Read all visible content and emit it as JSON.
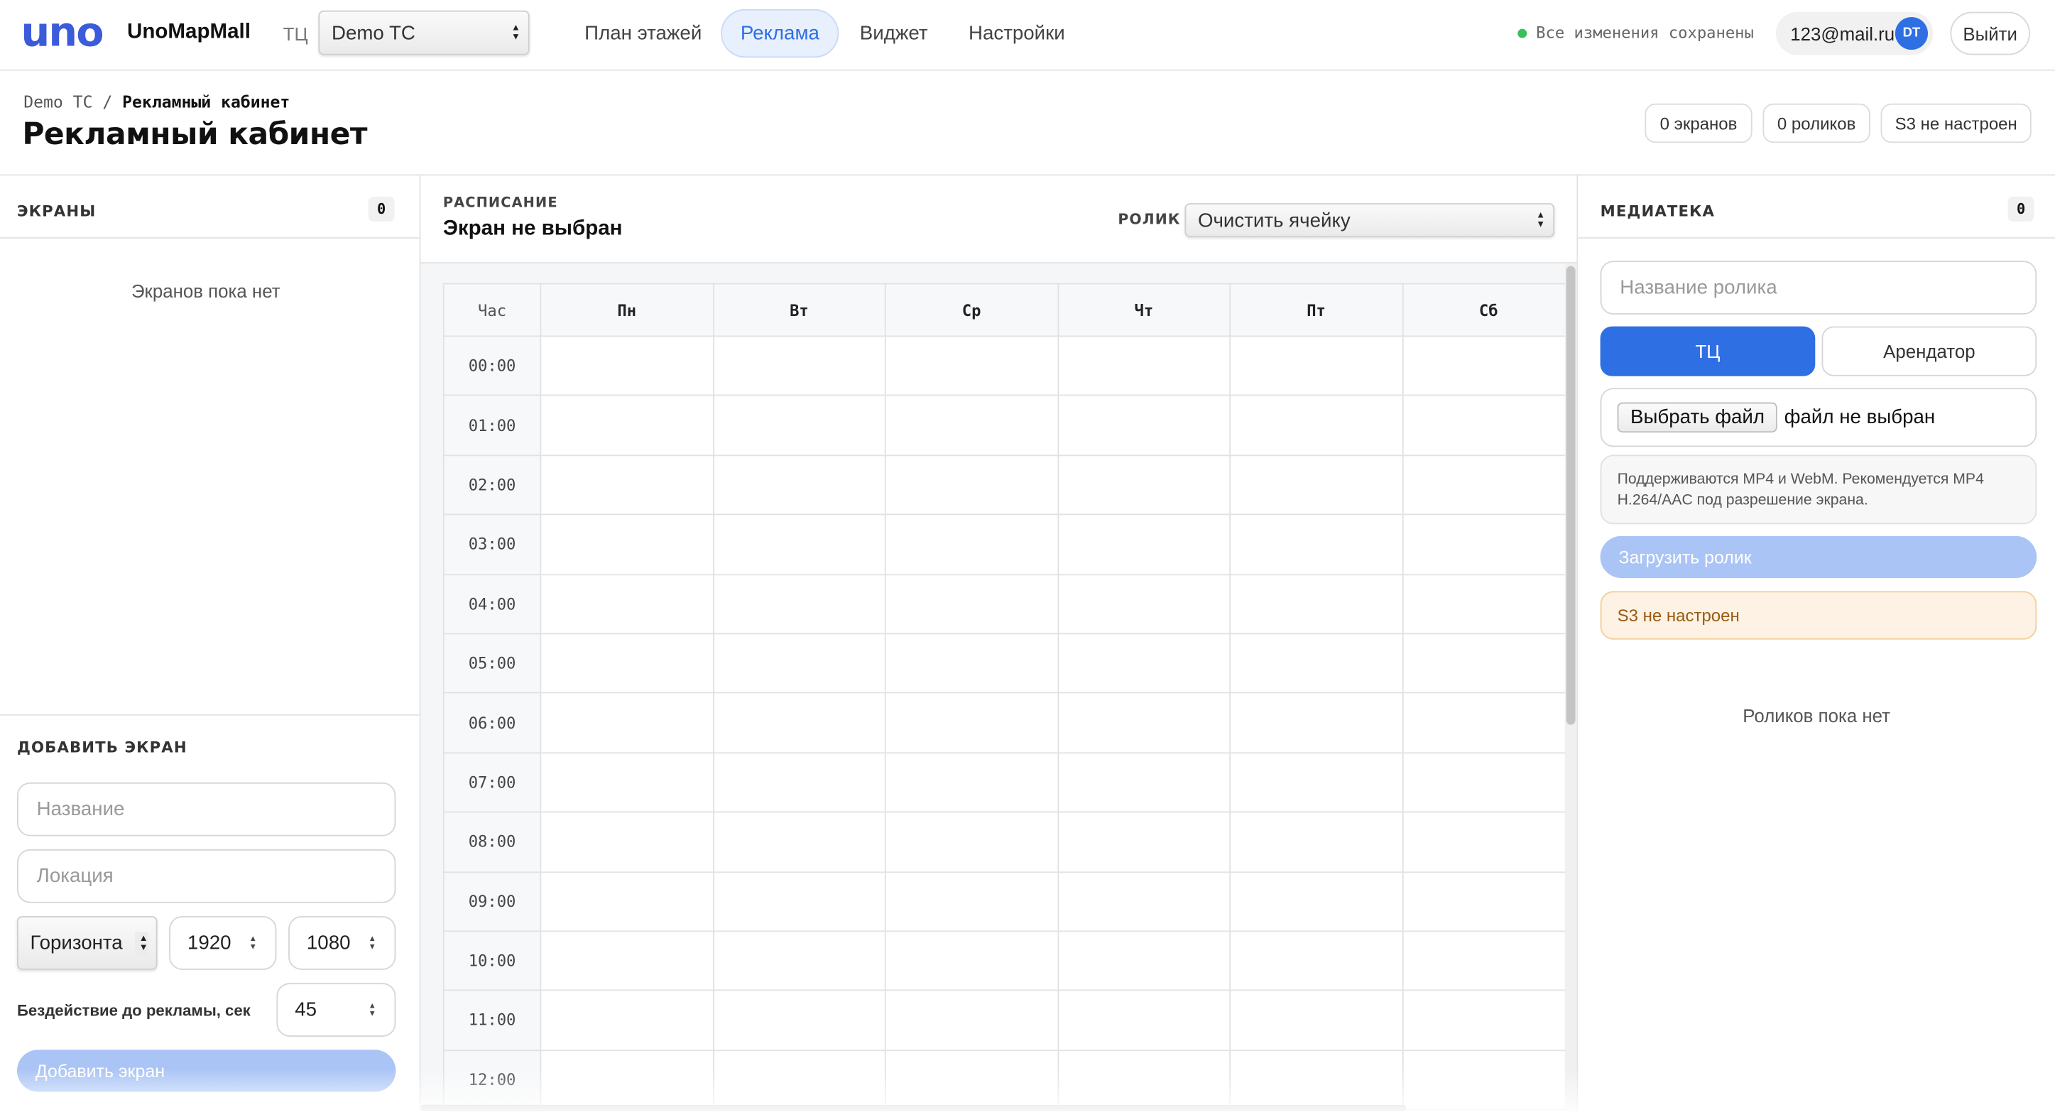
{
  "topbar": {
    "logo": "uno",
    "brand": "UnoMapMall",
    "tc_label": "ТЦ",
    "tc_selected": "Demo TC",
    "nav": [
      "План этажей",
      "Реклама",
      "Виджет",
      "Настройки"
    ],
    "active_nav": "Реклама",
    "saved_status": "Все изменения сохранены",
    "user_email": "123@mail.ru",
    "user_initials": "DT",
    "logout": "Выйти"
  },
  "header": {
    "breadcrumb_root": "Demo TC",
    "breadcrumb_sep": "/",
    "breadcrumb_current": "Рекламный кабинет",
    "title": "Рекламный кабинет",
    "badges": [
      "0 экранов",
      "0 роликов",
      "S3 не настроен"
    ]
  },
  "screens": {
    "title": "ЭКРАНЫ",
    "count": "0",
    "empty": "Экранов пока нет",
    "add": {
      "title": "ДОБАВИТЬ ЭКРАН",
      "name_placeholder": "Название",
      "location_placeholder": "Локация",
      "orientation": "Горизонта",
      "width": "1920",
      "height": "1080",
      "idle_label": "Бездействие до рекламы, сек",
      "idle_value": "45",
      "submit": "Добавить экран"
    }
  },
  "schedule": {
    "label": "РАСПИСАНИЕ",
    "title": "Экран не выбран",
    "role_label": "РОЛИК",
    "role_selected": "Очистить ячейку",
    "hour_header": "Час",
    "days": [
      "Пн",
      "Вт",
      "Ср",
      "Чт",
      "Пт",
      "Сб"
    ],
    "hours": [
      "00:00",
      "01:00",
      "02:00",
      "03:00",
      "04:00",
      "05:00",
      "06:00",
      "07:00",
      "08:00",
      "09:00",
      "10:00",
      "11:00",
      "12:00"
    ]
  },
  "media": {
    "title": "МЕДИАТЕКА",
    "count": "0",
    "name_placeholder": "Название ролика",
    "owner_options": [
      "ТЦ",
      "Арендатор"
    ],
    "owner_selected": "ТЦ",
    "file_button": "Выбрать файл",
    "file_status": "файл не выбран",
    "hint": "Поддерживаются MP4 и WebM. Рекомендуется MP4 H.264/AAC под разрешение экрана.",
    "upload": "Загрузить ролик",
    "warning": "S3 не настроен",
    "empty": "Роликов пока нет"
  },
  "colors": {
    "accent": "#2f6fe4",
    "accent_disabled": "#a9c4f5",
    "status_ok": "#38c15a",
    "warning_bg": "#fdf2e4",
    "warning_text": "#9a5a12"
  }
}
